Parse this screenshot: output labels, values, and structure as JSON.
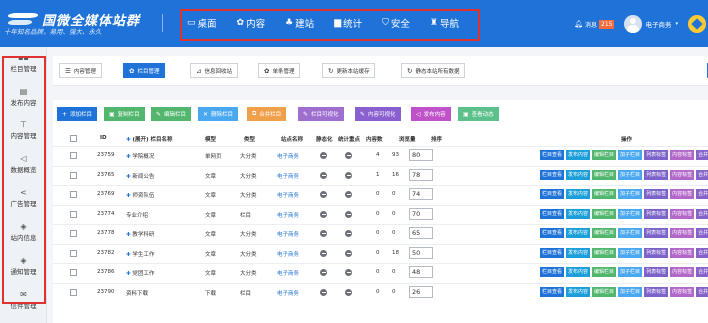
{
  "header": {
    "logo_title": "国微全媒体站群",
    "logo_subtitle": "十年知名品牌，易用、强大、永久",
    "nav": [
      {
        "icon": "desktop-icon",
        "glyph": "▭",
        "label": "桌面"
      },
      {
        "icon": "content-icon",
        "glyph": "✿",
        "label": "内容"
      },
      {
        "icon": "build-icon",
        "glyph": "♣",
        "label": "建站"
      },
      {
        "icon": "stats-icon",
        "glyph": "▆",
        "label": "统计"
      },
      {
        "icon": "security-icon",
        "glyph": "⛉",
        "label": "安全"
      },
      {
        "icon": "guide-icon",
        "glyph": "♜",
        "label": "导航"
      }
    ],
    "messages_label": "消息",
    "messages_count": "215",
    "user_name": "电子商务",
    "caret": "▾"
  },
  "sidebar": {
    "items": [
      {
        "icon": "grid-icon",
        "glyph": "▪▪",
        "label": "栏目管理"
      },
      {
        "icon": "document-icon",
        "glyph": "▤",
        "label": "发布内容"
      },
      {
        "icon": "pin-icon",
        "glyph": "⊤",
        "label": "内容管理"
      },
      {
        "icon": "send-icon",
        "glyph": "◁",
        "label": "数据概览"
      },
      {
        "icon": "share-icon",
        "glyph": "<",
        "label": "广告管理"
      },
      {
        "icon": "site-info-icon",
        "glyph": "◈",
        "label": "站内信息"
      },
      {
        "icon": "notice-icon",
        "glyph": "◈",
        "label": "通知管理"
      },
      {
        "icon": "mail-icon",
        "glyph": "✉",
        "label": "信件管理"
      }
    ]
  },
  "toolbar": {
    "items": [
      {
        "icon": "list-icon",
        "glyph": "☰",
        "label": "内容管理"
      },
      {
        "icon": "gear-icon",
        "glyph": "✿",
        "label": "栏目管理"
      },
      {
        "icon": "chart-icon",
        "glyph": "⊿",
        "label": "信息回收站"
      },
      {
        "icon": "settings-icon",
        "glyph": "✿",
        "label": "单条管理"
      },
      {
        "icon": "refresh-icon",
        "glyph": "↻",
        "label": "更新本站缓存"
      },
      {
        "icon": "refresh-all-icon",
        "glyph": "↻",
        "label": "静态本站所有数据"
      }
    ]
  },
  "actions": [
    {
      "icon": "plus-icon",
      "glyph": "+",
      "label": "添加栏目",
      "color": "#1f73d8"
    },
    {
      "icon": "copy-icon",
      "glyph": "▣",
      "label": "复制栏目",
      "color": "#52b66e"
    },
    {
      "icon": "edit-icon",
      "glyph": "✎",
      "label": "编辑栏目",
      "color": "#52b66e"
    },
    {
      "icon": "delete-icon",
      "glyph": "✕",
      "label": "删除栏目",
      "color": "#4aa8f0"
    },
    {
      "icon": "merge-icon",
      "glyph": "⧉",
      "label": "合并栏目",
      "color": "#f0a04b"
    },
    {
      "icon": "visualize-icon",
      "glyph": "✎",
      "label": "栏目可视化",
      "color": "#9f6fd0"
    },
    {
      "icon": "content-visualize-icon",
      "glyph": "✎",
      "label": "内容可视化",
      "color": "#8a5fd0"
    },
    {
      "icon": "publish-icon",
      "glyph": "◁",
      "label": "发布内容",
      "color": "#c052c9"
    },
    {
      "icon": "activity-icon",
      "glyph": "▣",
      "label": "查看动态",
      "color": "#5cc08a"
    }
  ],
  "table": {
    "headers": [
      "ID",
      "(展开) 栏目名称",
      "模型",
      "类型",
      "站点名称",
      "静态化",
      "统计重点",
      "内容数",
      "浏览量",
      "排序",
      "操作"
    ],
    "rows": [
      {
        "id": "23759",
        "name": "学院概况",
        "expand": "+",
        "model": "单网页",
        "type": "大分类",
        "site": "电子商务",
        "count": "4",
        "views": "93",
        "sort": "80"
      },
      {
        "id": "23765",
        "name": "新闻公告",
        "expand": "+",
        "model": "文章",
        "type": "大分类",
        "site": "电子商务",
        "count": "1",
        "views": "16",
        "sort": "78"
      },
      {
        "id": "23769",
        "name": "师资队伍",
        "expand": "+",
        "model": "文章",
        "type": "大分类",
        "site": "电子商务",
        "count": "0",
        "views": "0",
        "sort": "74"
      },
      {
        "id": "23774",
        "name": "专业介绍",
        "expand": "",
        "model": "文章",
        "type": "栏目",
        "site": "电子商务",
        "count": "0",
        "views": "0",
        "sort": "70"
      },
      {
        "id": "23778",
        "name": "教学科研",
        "expand": "+",
        "model": "文章",
        "type": "大分类",
        "site": "电子商务",
        "count": "0",
        "views": "0",
        "sort": "65"
      },
      {
        "id": "23782",
        "name": "学生工作",
        "expand": "+",
        "model": "文章",
        "type": "大分类",
        "site": "电子商务",
        "count": "0",
        "views": "18",
        "sort": "50"
      },
      {
        "id": "23786",
        "name": "党团工作",
        "expand": "+",
        "model": "文章",
        "type": "大分类",
        "site": "电子商务",
        "count": "0",
        "views": "0",
        "sort": "48"
      },
      {
        "id": "23790",
        "name": "资料下载",
        "expand": "",
        "model": "下载",
        "type": "栏目",
        "site": "电子商务",
        "count": "0",
        "views": "0",
        "sort": "26"
      }
    ],
    "ops": [
      "栏目查看",
      "发布内容",
      "编辑栏目",
      "加子栏目",
      "列表标签",
      "内容标签",
      "合并",
      "克隆"
    ]
  }
}
